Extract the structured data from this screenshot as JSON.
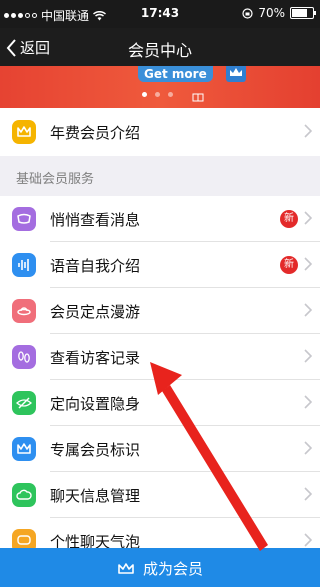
{
  "status_bar": {
    "carrier": "中国联通",
    "time": "17:43",
    "battery": "70%"
  },
  "nav": {
    "back_label": "返回",
    "title": "会员中心"
  },
  "banner": {
    "promo_text": "Get more"
  },
  "top_item": {
    "label": "年费会员介绍",
    "icon": "crown-icon",
    "color": "#f5b400"
  },
  "section": {
    "header": "基础会员服务",
    "items": [
      {
        "label": "悄悄查看消息",
        "icon": "goggles-icon",
        "color": "#a46de0",
        "badge": "新"
      },
      {
        "label": "语音自我介绍",
        "icon": "voice-wave-icon",
        "color": "#2e8ff0",
        "badge": "新"
      },
      {
        "label": "会员定点漫游",
        "icon": "ufo-icon",
        "color": "#f06e7a",
        "badge": ""
      },
      {
        "label": "查看访客记录",
        "icon": "footprint-icon",
        "color": "#a46de0",
        "badge": ""
      },
      {
        "label": "定向设置隐身",
        "icon": "hidden-eye-icon",
        "color": "#2ec45c",
        "badge": ""
      },
      {
        "label": "专属会员标识",
        "icon": "crown-icon",
        "color": "#2e8ff0",
        "badge": ""
      },
      {
        "label": "聊天信息管理",
        "icon": "cloud-icon",
        "color": "#2ec45c",
        "badge": ""
      },
      {
        "label": "个性聊天气泡",
        "icon": "bubble-icon",
        "color": "#f5a623",
        "badge": ""
      }
    ]
  },
  "bottom_button": {
    "label": "成为会员"
  }
}
